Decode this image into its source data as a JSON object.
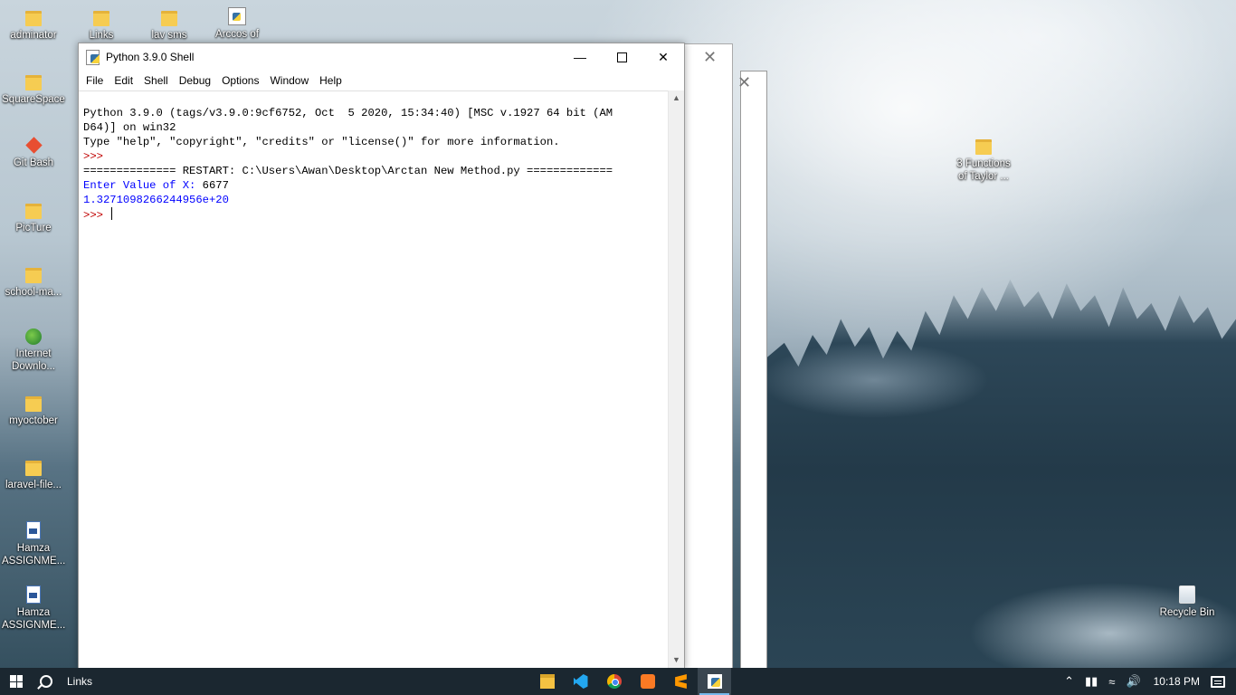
{
  "desktop": {
    "icons_left": [
      {
        "label": "adminator"
      },
      {
        "label": "SquareSpace"
      },
      {
        "label": "Git Bash"
      },
      {
        "label": "PicTure"
      },
      {
        "label": "school-ma..."
      },
      {
        "label": "Internet Downlo..."
      },
      {
        "label": "myoctober"
      },
      {
        "label": "laravel-file..."
      },
      {
        "label": "Hamza ASSIGNME..."
      },
      {
        "label": "Hamza ASSIGNME..."
      }
    ],
    "icons_top": [
      {
        "label": "Links"
      },
      {
        "label": "lav sms"
      },
      {
        "label": "Arccos of"
      }
    ],
    "icons_right": [
      {
        "label": "3 Functions of Taylor ..."
      },
      {
        "label": "Recycle Bin"
      }
    ]
  },
  "window": {
    "title": "Python 3.9.0 Shell",
    "menu": [
      "File",
      "Edit",
      "Shell",
      "Debug",
      "Options",
      "Window",
      "Help"
    ],
    "lines": {
      "l1": "Python 3.9.0 (tags/v3.9.0:9cf6752, Oct  5 2020, 15:34:40) [MSC v.1927 64 bit (AM",
      "l2": "D64)] on win32",
      "l3": "Type \"help\", \"copyright\", \"credits\" or \"license()\" for more information.",
      "prompt1": ">>> ",
      "restart": "============== RESTART: C:\\Users\\Awan\\Desktop\\Arctan New Method.py =============",
      "input_prompt": "Enter Value of X: ",
      "input_value": "6677",
      "output": "1.3271098266244956e+20",
      "prompt2": ">>> "
    }
  },
  "taskbar": {
    "search_text": "Links",
    "apps": [
      "file-explorer",
      "vscode",
      "chrome",
      "xampp",
      "sublime-text",
      "python-idle"
    ],
    "clock": "10:18 PM"
  }
}
